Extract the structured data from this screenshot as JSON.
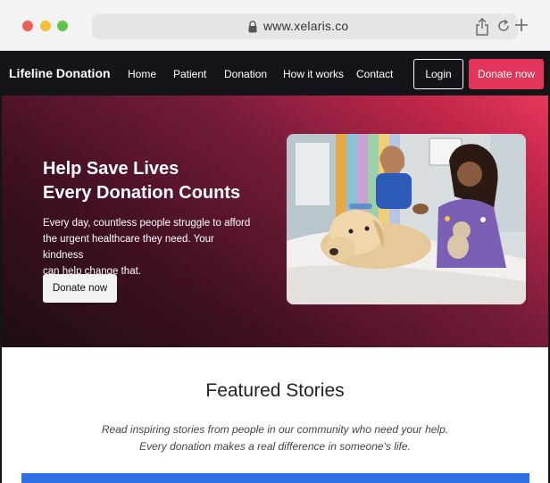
{
  "browser": {
    "url": "www.xelaris.co"
  },
  "nav": {
    "brand": "Lifeline Donation",
    "links": [
      "Home",
      "Patient",
      "Donation",
      "How it works",
      "Contact"
    ],
    "login_label": "Login",
    "donate_label": "Donate now"
  },
  "hero": {
    "title_line1": "Help Save Lives",
    "title_line2": "Every Donation Counts",
    "text_line1": "Every day, countless people struggle to afford",
    "text_line2": "the urgent healthcare they need. Your kindness",
    "text_line3": "can help change that.",
    "button_label": "Donate now"
  },
  "featured": {
    "title": "Featured Stories",
    "subtitle_line1": "Read inspiring stories from people in our community who need your help.",
    "subtitle_line2": "Every donation makes a real difference in someone's life."
  },
  "colors": {
    "accent": "#e23559",
    "nav_bg": "#15141a",
    "featured_bar": "#2f6fe6"
  },
  "icons": [
    "lock-icon",
    "share-icon",
    "reload-icon",
    "plus-icon"
  ]
}
